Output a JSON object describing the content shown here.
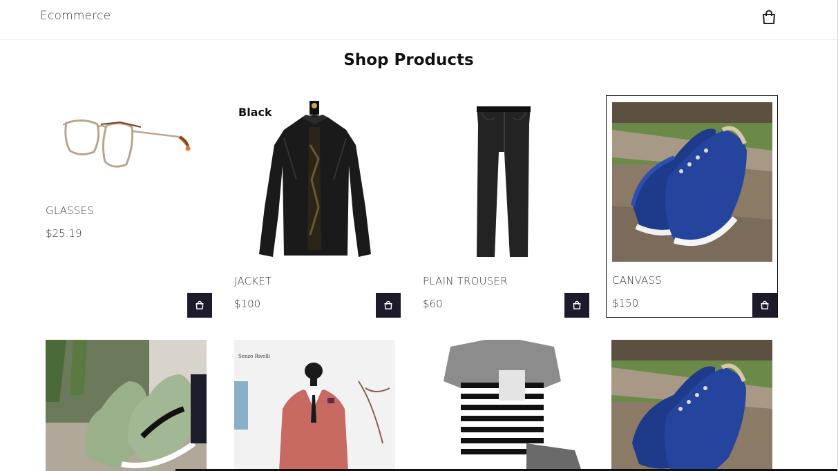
{
  "header": {
    "brand": "Ecommerce",
    "cart_icon": "shopping-bag-icon"
  },
  "page": {
    "title": "Shop Products"
  },
  "products": [
    {
      "name": "GLASSES",
      "price": "$25.19",
      "image": "glasses"
    },
    {
      "name": "JACKET",
      "price": "$100",
      "image": "leather-jacket",
      "image_label": "Black"
    },
    {
      "name": "PLAIN TROUSER",
      "price": "$60",
      "image": "trousers"
    },
    {
      "name": "CANVASS",
      "price": "$150",
      "image": "blue-canvas-shoes"
    },
    {
      "name": "",
      "price": "",
      "image": "green-sneakers"
    },
    {
      "name": "",
      "price": "",
      "image": "red-suit",
      "image_label": "Senzo Rivelli"
    },
    {
      "name": "",
      "price": "",
      "image": "striped-tshirt"
    },
    {
      "name": "",
      "price": "",
      "image": "blue-canvas-shoes"
    }
  ],
  "colors": {
    "button": "#1d1b2b",
    "text": "#333333"
  }
}
